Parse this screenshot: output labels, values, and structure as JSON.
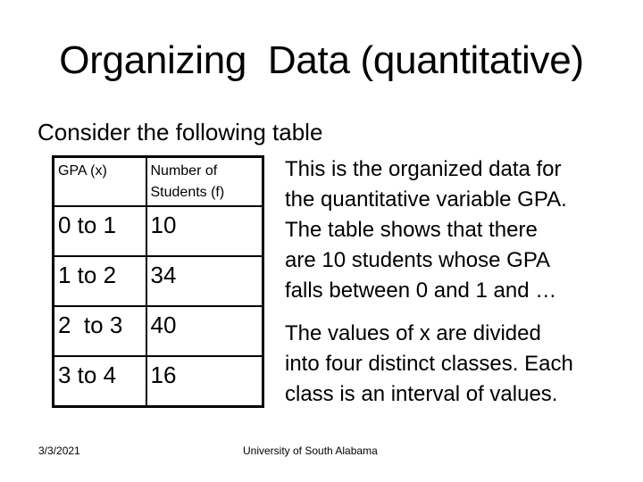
{
  "slide": {
    "title": "Organizing  Data (quantitative)",
    "intro": "Consider the following table"
  },
  "table": {
    "headers": [
      "GPA (x)",
      "Number of Students (f)"
    ],
    "rows": [
      {
        "gpa": "0 to 1",
        "count": "10"
      },
      {
        "gpa": "1 to 2",
        "count": "34"
      },
      {
        "gpa": "2  to 3",
        "count": "40"
      },
      {
        "gpa": "3 to 4",
        "count": "16"
      }
    ]
  },
  "description": {
    "paragraph1": [
      "This is the organized data for",
      "the quantitative variable GPA.",
      "The table shows that there",
      "are 10 students whose GPA",
      "falls between 0 and 1 and …"
    ],
    "paragraph2": [
      "The values of x are divided",
      "into four distinct classes. Each",
      "class is an interval of values."
    ]
  },
  "footer": {
    "date": "3/3/2021",
    "organization": "University of South Alabama"
  }
}
